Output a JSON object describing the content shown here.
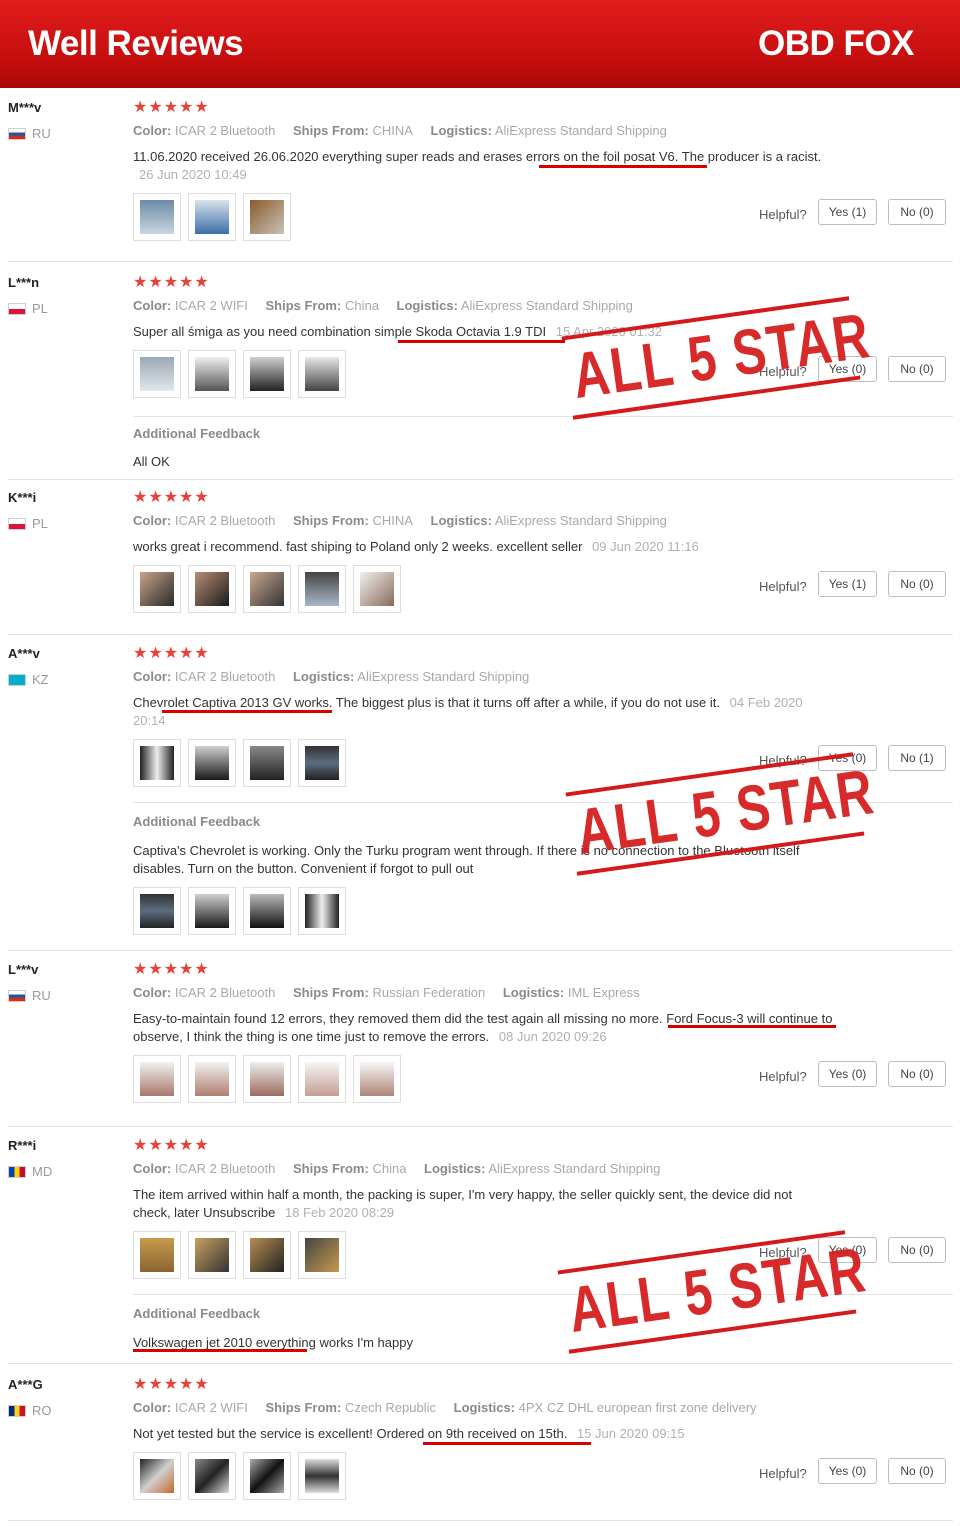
{
  "banner": {
    "left": "Well Reviews",
    "right": "OBD FOX"
  },
  "stamp_text": "ALL 5 STAR",
  "labels": {
    "color": "Color:",
    "ships_from": "Ships From:",
    "logistics": "Logistics:",
    "helpful": "Helpful?",
    "additional_feedback": "Additional Feedback"
  },
  "stars": "★★★★★",
  "reviews": [
    {
      "user": "M***v",
      "country": "RU",
      "color": "ICAR 2 Bluetooth",
      "ships_from": "CHINA",
      "logistics": "AliExpress Standard Shipping",
      "text": "11.06.2020 received 26.06.2020 everything super reads and erases errors on the foil posat V6. The producer is a racist.",
      "date": "26 Jun 2020 10:49",
      "yes": "Yes (1)",
      "no": "No (0)"
    },
    {
      "user": "L***n",
      "country": "PL",
      "color": "ICAR 2 WIFI",
      "ships_from": "China",
      "logistics": "AliExpress Standard Shipping",
      "text": "Super all śmiga as you need combination simple Skoda Octavia 1.9 TDI",
      "date": "15 Apr 2020 01:32",
      "yes": "Yes (0)",
      "no": "No (0)",
      "feedback": "All OK"
    },
    {
      "user": "K***i",
      "country": "PL",
      "color": "ICAR 2 Bluetooth",
      "ships_from": "CHINA",
      "logistics": "AliExpress Standard Shipping",
      "text": "works great i recommend. fast shiping to Poland only 2 weeks. excellent seller",
      "date": "09 Jun 2020 11:16",
      "yes": "Yes (1)",
      "no": "No (0)"
    },
    {
      "user": "A***v",
      "country": "KZ",
      "color": "ICAR 2 Bluetooth",
      "logistics": "AliExpress Standard Shipping",
      "text": "Chevrolet Captiva 2013 GV works. The biggest plus is that it turns off after a while, if you do not use it.",
      "date": "04 Feb 2020 20:14",
      "yes": "Yes (0)",
      "no": "No (1)",
      "feedback": "Captiva's Chevrolet is working. Only the Turku program went through. If there is no connection to the Bluetooth itself disables. Turn on the button. Convenient if forgot to pull out"
    },
    {
      "user": "L***v",
      "country": "RU",
      "color": "ICAR 2 Bluetooth",
      "ships_from": "Russian Federation",
      "logistics": "IML Express",
      "text": "Easy-to-maintain found 12 errors, they removed them did the test again all missing no more. Ford Focus-3 will continue to observe, I think the thing is one time just to remove the errors.",
      "date": "08 Jun 2020 09:26",
      "yes": "Yes (0)",
      "no": "No (0)"
    },
    {
      "user": "R***i",
      "country": "MD",
      "color": "ICAR 2 Bluetooth",
      "ships_from": "China",
      "logistics": "AliExpress Standard Shipping",
      "text": "The item arrived within half a month, the packing is super, I'm very happy, the seller quickly sent, the device did not check, later Unsubscribe",
      "date": "18 Feb 2020 08:29",
      "yes": "Yes (0)",
      "no": "No (0)",
      "feedback": "Volkswagen jet 2010 everything works I'm happy"
    },
    {
      "user": "A***G",
      "country": "RO",
      "color": "ICAR 2 WIFI",
      "ships_from": "Czech Republic",
      "logistics": "4PX CZ DHL european first zone delivery",
      "text": "Not yet tested but the service is excellent! Ordered on 9th received on 15th.",
      "date": "15 Jun 2020 09:15",
      "yes": "Yes (0)",
      "no": "No (0)"
    }
  ],
  "flag_colors": {
    "RU": [
      "#ffffff",
      "#1c57a5",
      "#d52b1e"
    ],
    "PL": [
      "#ffffff",
      "#dc143c"
    ],
    "MD": [
      "#0046ae",
      "#ffd200",
      "#cc092f"
    ],
    "RO": [
      "#002b7f",
      "#fcd116",
      "#ce1126"
    ],
    "KZ": [
      "#00afca"
    ]
  },
  "accent": "#d50000",
  "star_color": "#e8413a"
}
